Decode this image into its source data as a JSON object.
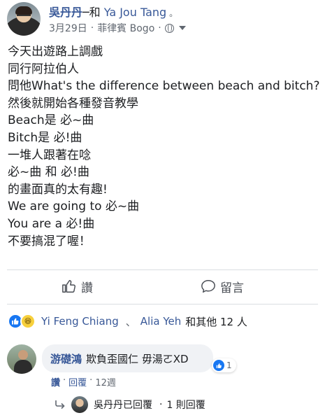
{
  "header": {
    "author": "吳丹丹",
    "with_text": "─和",
    "tagged": "Ya Jou Tang",
    "dot": "。",
    "date": "3月29日",
    "sep": "·",
    "location": "菲律賓 Bogo",
    "sep2": "·"
  },
  "post": {
    "lines": [
      "今天出遊路上調戲",
      "同行阿拉伯人",
      "問他What's the difference between beach and bitch?",
      "然後就開始各種發音教學",
      "Beach是 必~曲",
      "Bitch是 必!曲",
      "一堆人跟著在唸",
      "必~曲 和 必!曲",
      "的畫面真的太有趣!",
      "We are going to 必~曲",
      "You are a 必!曲",
      "不要搞混了喔！"
    ]
  },
  "actions": {
    "like": "讚",
    "comment": "留言"
  },
  "reactions": {
    "name1": "Yi Feng Chiang",
    "sep": "、",
    "name2": "Alia Yeh",
    "rest": "和其他 12 人",
    "haha": "😆"
  },
  "comment": {
    "author": "游礎鴻",
    "text": "欺負歪國仁 毋湯ㄛXD",
    "like_count": "1",
    "like_link": "讚",
    "middot": "·",
    "reply_link": "回覆",
    "middot2": "·",
    "time": "12週"
  },
  "reply": {
    "name": "吳丹丹已回覆",
    "middot": "·",
    "count": "1 則回覆"
  },
  "colors": {
    "link": "#385898",
    "like_blue": "#1877f2",
    "divider": "#dadde1"
  }
}
